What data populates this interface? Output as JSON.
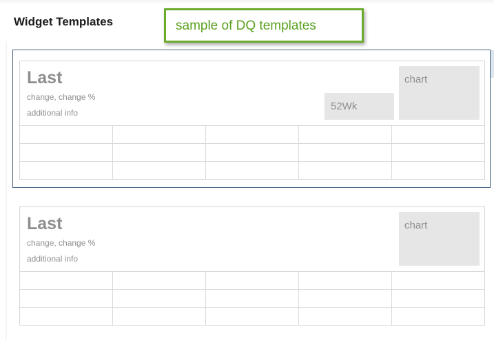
{
  "panel": {
    "title": "Widget Templates"
  },
  "callout": {
    "text": "sample of DQ templates",
    "border_color": "#6aaa2c",
    "text_color": "#59a01f"
  },
  "templates": [
    {
      "selected": true,
      "last_label": "Last",
      "change_label": "change, change %",
      "info_label": "additional info",
      "week52_label": "52Wk",
      "chart_label": "chart",
      "table": {
        "rows": 3,
        "cols": 5
      }
    },
    {
      "selected": false,
      "last_label": "Last",
      "change_label": "change, change %",
      "info_label": "additional info",
      "chart_label": "chart",
      "table": {
        "rows": 3,
        "cols": 5
      }
    }
  ],
  "colors": {
    "selected_border": "#40607e",
    "placeholder_bg": "#e6e6e6",
    "placeholder_text": "#8e8e8e"
  }
}
